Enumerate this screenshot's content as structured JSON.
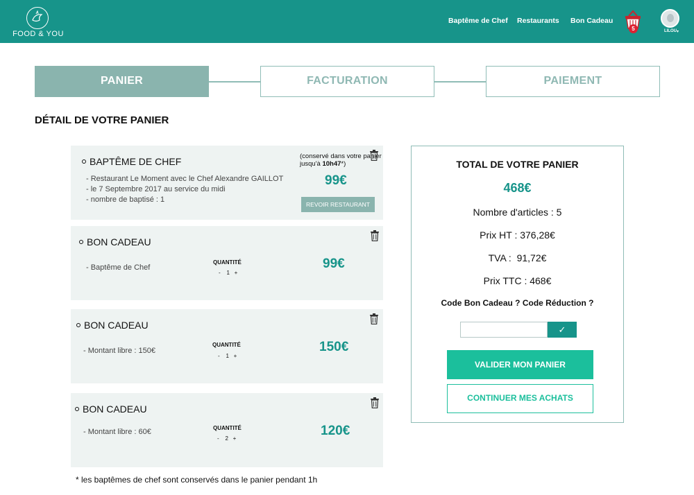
{
  "header": {
    "logo_text": "FOOD & YOU",
    "nav": [
      "Baptême de Chef",
      "Restaurants",
      "Bon Cadeau"
    ],
    "cart_count": "5",
    "user_name": "LILOU",
    "caret": "▾"
  },
  "steps": [
    "PANIER",
    "FACTURATION",
    "PAIEMENT"
  ],
  "section_title": "DÉTAIL DE VOTRE PANIER",
  "items": [
    {
      "title": "BAPTÊME DE CHEF",
      "note_prefix": "(conservé dans votre panier jusqu'à ",
      "note_time": "10h47",
      "note_suffix": "*)",
      "details": [
        "- Restaurant Le Moment avec le Chef Alexandre GAILLOT",
        "- le 7 Septembre 2017 au service du midi",
        "- nombre de baptisé : 1"
      ],
      "price": "99€",
      "button": "REVOIR RESTAURANT"
    },
    {
      "title": "BON CADEAU",
      "details": [
        "- Baptême de Chef"
      ],
      "qty_label": "QUANTITÉ",
      "qty": "-    1   +",
      "price": "99€"
    },
    {
      "title": "BON CADEAU",
      "details": [
        "- Montant libre : 150€"
      ],
      "qty_label": "QUANTITÉ",
      "qty": "-    1   +",
      "price": "150€"
    },
    {
      "title": "BON CADEAU",
      "details": [
        "- Montant libre : 60€"
      ],
      "qty_label": "QUANTITÉ",
      "qty": "-    2   +",
      "price": "120€"
    }
  ],
  "footnote": "* les baptêmes de chef sont conservés dans le panier pendant 1h",
  "summary": {
    "title": "TOTAL DE VOTRE PANIER",
    "total": "468€",
    "articles": "Nombre d'articles : 5",
    "ht": "Prix HT : 376,28€",
    "tva": "TVA :  91,72€",
    "ttc": "Prix TTC : 468€",
    "code_label": "Code Bon Cadeau ? Code Réduction ?",
    "code_value": "",
    "code_btn": "✓",
    "validate": "VALIDER MON PANIER",
    "continue": "CONTINUER MES ACHATS"
  },
  "colors": {
    "brand": "#17948a",
    "step_active": "#8ab4ae",
    "button": "#1bbf9c",
    "item_bg": "#eef3f2"
  }
}
